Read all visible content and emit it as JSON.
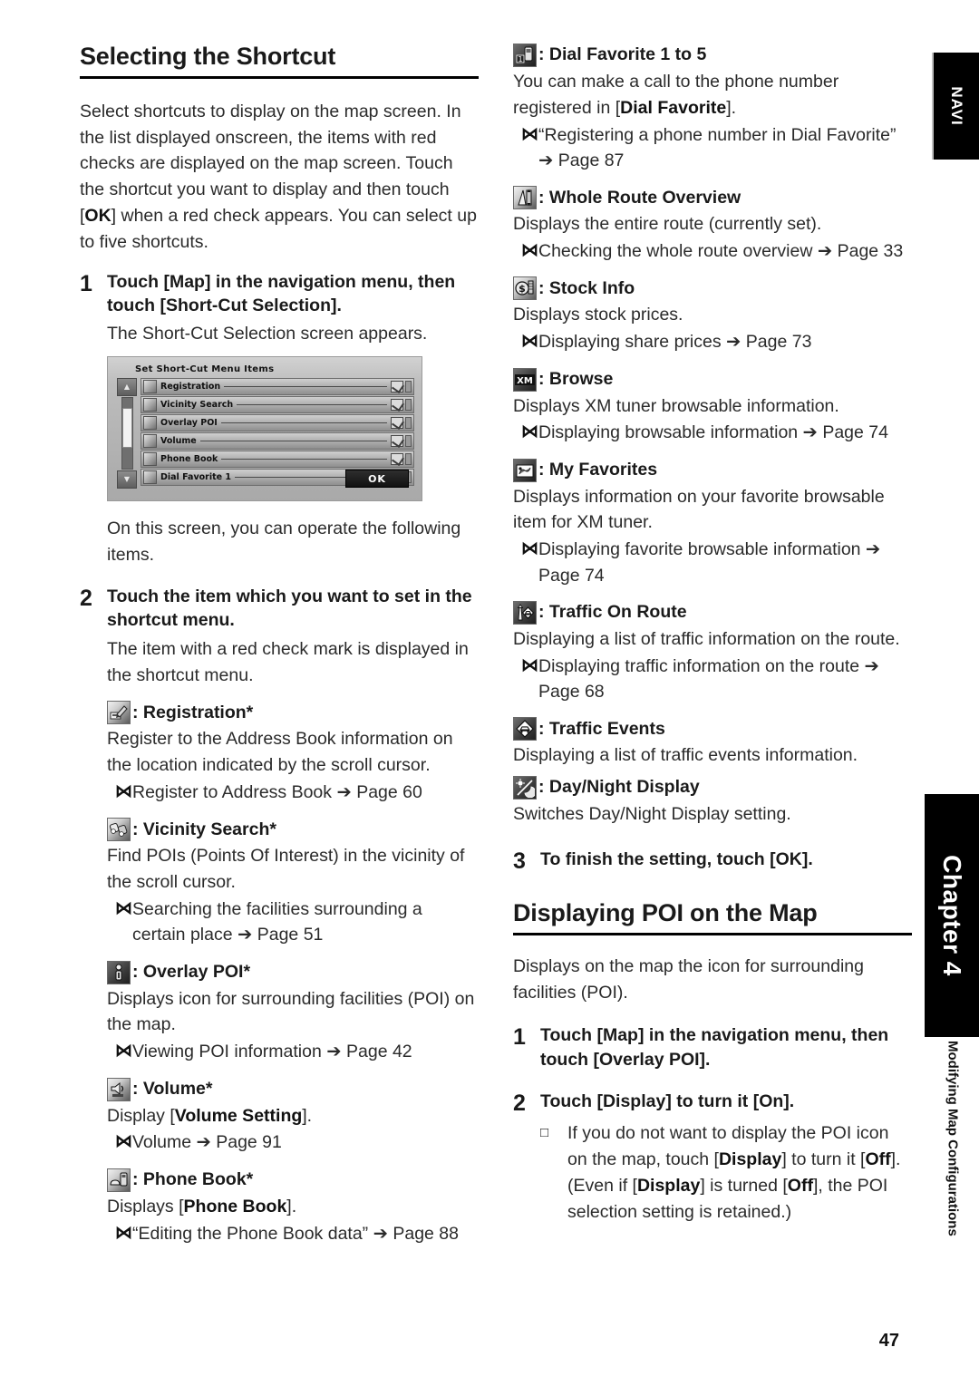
{
  "page": {
    "number": "47",
    "side_tab_top": "NAVI",
    "side_tab_chapter": "Chapter 4",
    "side_tab_chapter_sub": "Modifying Map Configurations"
  },
  "left": {
    "title": "Selecting the Shortcut",
    "intro": "Select shortcuts to display on the map screen. In the list displayed onscreen, the items with red checks are displayed on the map screen. Touch the shortcut you want to display and then touch [OK] when a red check appears. You can select up to five shortcuts.",
    "intro_bold_token": "OK",
    "step1": {
      "num": "1",
      "text": "Touch [Map] in the navigation menu, then touch [Short-Cut Selection].",
      "sub": "The Short-Cut Selection screen appears."
    },
    "screenshot": {
      "title": "Set Short-Cut Menu Items",
      "ok_label": "OK",
      "rows": [
        {
          "label": "Registration",
          "checked": true,
          "icon": "registration-icon"
        },
        {
          "label": "Vicinity Search",
          "checked": true,
          "icon": "binoculars-icon"
        },
        {
          "label": "Overlay POI",
          "checked": true,
          "icon": "info-person-icon"
        },
        {
          "label": "Volume",
          "checked": true,
          "icon": "speaker-icon"
        },
        {
          "label": "Phone Book",
          "checked": true,
          "icon": "phone-book-icon"
        },
        {
          "label": "Dial Favorite 1",
          "checked": false,
          "icon": "dial-favorite-icon"
        }
      ],
      "scroll_up": "▲",
      "scroll_down": "▼"
    },
    "after_shot": "On this screen, you can operate the following items.",
    "step2": {
      "num": "2",
      "text": "Touch the item which you want to set in the shortcut menu.",
      "sub": "The item with a red check mark is displayed in the shortcut menu."
    },
    "items": [
      {
        "icon": "registration-icon",
        "name": ": Registration*",
        "desc": "Register to the Address Book information on the location indicated by the scroll cursor.",
        "xrefs": [
          "Register to Address Book ➔ Page 60"
        ]
      },
      {
        "icon": "binoculars-icon",
        "name": ": Vicinity Search*",
        "desc": "Find POIs (Points Of Interest) in the vicinity of the scroll cursor.",
        "xrefs": [
          "Searching the facilities surrounding a certain place ➔ Page 51"
        ]
      },
      {
        "icon": "info-person-icon",
        "name": ": Overlay POI*",
        "desc": "Displays icon for surrounding facilities (POI) on the map.",
        "xrefs": [
          "Viewing POI information ➔ Page 42"
        ]
      },
      {
        "icon": "speaker-icon",
        "name": ": Volume*",
        "desc": "Display [Volume Setting].",
        "desc_bold": "Volume Setting",
        "xrefs": [
          "Volume ➔ Page 91"
        ]
      },
      {
        "icon": "phone-book-icon",
        "name": ": Phone Book*",
        "desc": "Displays [Phone Book].",
        "desc_bold": "Phone Book",
        "xrefs": [
          "“Editing the Phone Book data” ➔ Page 88"
        ]
      }
    ]
  },
  "right": {
    "items": [
      {
        "icon": "dial-favorite-icon",
        "name": ": Dial Favorite 1 to 5",
        "desc": "You can make a call to the phone number registered in [Dial Favorite].",
        "desc_bold": "Dial Favorite",
        "xrefs": [
          "“Registering a phone number in Dial Favorite” ➔ Page 87"
        ]
      },
      {
        "icon": "route-overview-icon",
        "name": ": Whole Route Overview",
        "desc": "Displays the entire route (currently set).",
        "xrefs": [
          "Checking the whole route overview ➔ Page 33"
        ]
      },
      {
        "icon": "stock-info-icon",
        "name": ": Stock Info",
        "desc": "Displays stock prices.",
        "xrefs": [
          "Displaying share prices ➔ Page 73"
        ]
      },
      {
        "icon": "xm-browse-icon",
        "name": ": Browse",
        "desc": "Displays XM tuner browsable information.",
        "xrefs": [
          "Displaying browsable information ➔ Page 74"
        ]
      },
      {
        "icon": "my-favorites-icon",
        "name": ": My Favorites",
        "desc": "Displays information on your favorite browsable item for XM tuner.",
        "xrefs": [
          "Displaying favorite browsable information ➔ Page 74"
        ]
      },
      {
        "icon": "traffic-on-route-icon",
        "name": ": Traffic On Route",
        "desc": "Displaying a list of traffic information on the route.",
        "xrefs": [
          "Displaying traffic information on the route ➔ Page 68"
        ]
      },
      {
        "icon": "traffic-events-icon",
        "name": ": Traffic Events",
        "desc": "Displaying a list of traffic events information.",
        "xrefs": []
      },
      {
        "icon": "day-night-icon",
        "name": ": Day/Night Display",
        "desc": "Switches Day/Night Display setting.",
        "xrefs": []
      }
    ],
    "step3": {
      "num": "3",
      "text": "To finish the setting, touch [OK]."
    },
    "title": "Displaying POI on the Map",
    "intro": "Displays on the map the icon for surrounding facilities (POI).",
    "step1": {
      "num": "1",
      "text": "Touch [Map] in the navigation menu, then touch [Overlay POI]."
    },
    "step2": {
      "num": "2",
      "text": "Touch [Display] to turn it [On].",
      "note": "If you do not want to display the POI icon on the map, touch [Display] to turn it [Off]. (Even if [Display] is turned [Off], the POI selection setting is retained.)",
      "note_bold_tokens": [
        "Display",
        "Off",
        "Display",
        "Off"
      ]
    }
  }
}
